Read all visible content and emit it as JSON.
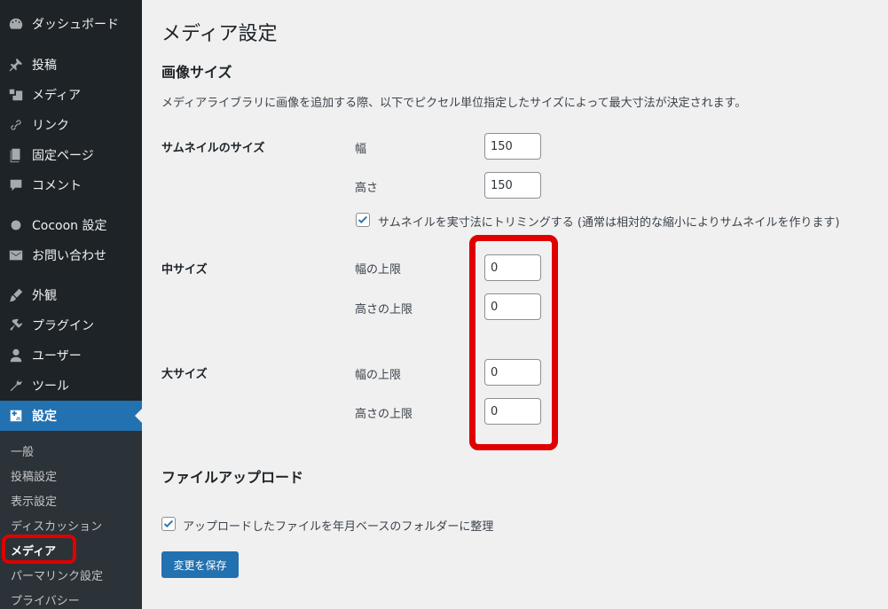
{
  "sidebar": {
    "items": [
      {
        "label": "ダッシュボード",
        "icon": "dashboard-icon"
      },
      {
        "label": "投稿",
        "icon": "pin-icon"
      },
      {
        "label": "メディア",
        "icon": "media-icon"
      },
      {
        "label": "リンク",
        "icon": "link-icon"
      },
      {
        "label": "固定ページ",
        "icon": "page-icon"
      },
      {
        "label": "コメント",
        "icon": "comment-icon"
      },
      {
        "label": "Cocoon 設定",
        "icon": "circle-icon"
      },
      {
        "label": "お問い合わせ",
        "icon": "mail-icon"
      },
      {
        "label": "外観",
        "icon": "brush-icon"
      },
      {
        "label": "プラグイン",
        "icon": "plugin-icon"
      },
      {
        "label": "ユーザー",
        "icon": "user-icon"
      },
      {
        "label": "ツール",
        "icon": "wrench-icon"
      },
      {
        "label": "設定",
        "icon": "settings-icon"
      }
    ],
    "submenu": [
      "一般",
      "投稿設定",
      "表示設定",
      "ディスカッション",
      "メディア",
      "パーマリンク設定",
      "プライバシー"
    ]
  },
  "main": {
    "page_title": "メディア設定",
    "image_sizes_title": "画像サイズ",
    "description": "メディアライブラリに画像を追加する際、以下でピクセル単位指定したサイズによって最大寸法が決定されます。",
    "thumbnail": {
      "label": "サムネイルのサイズ",
      "width_label": "幅",
      "width_value": "150",
      "height_label": "高さ",
      "height_value": "150",
      "crop_label": "サムネイルを実寸法にトリミングする (通常は相対的な縮小によりサムネイルを作ります)",
      "crop_checked": true
    },
    "medium": {
      "label": "中サイズ",
      "width_label": "幅の上限",
      "width_value": "0",
      "height_label": "高さの上限",
      "height_value": "0"
    },
    "large": {
      "label": "大サイズ",
      "width_label": "幅の上限",
      "width_value": "0",
      "height_label": "高さの上限",
      "height_value": "0"
    },
    "upload_title": "ファイルアップロード",
    "upload_label": "アップロードしたファイルを年月ベースのフォルダーに整理",
    "upload_checked": true,
    "save_label": "変更を保存"
  },
  "colors": {
    "accent": "#2271b1",
    "sidebar_bg": "#1d2327",
    "highlight": "#e00000"
  }
}
